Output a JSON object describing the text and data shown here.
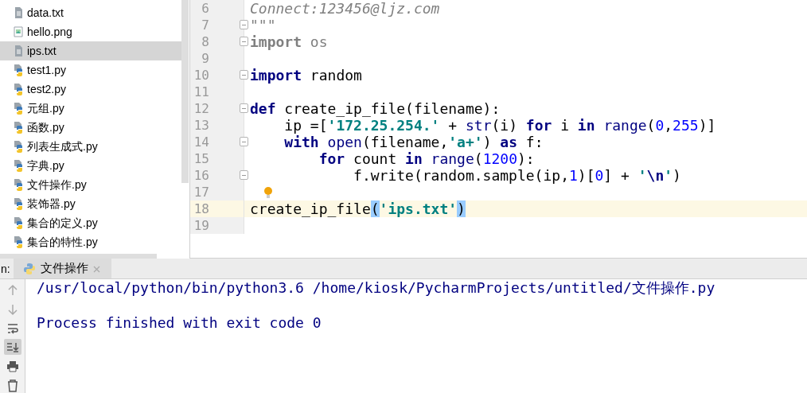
{
  "project_tree": {
    "items": [
      {
        "name": "data.txt",
        "kind": "text",
        "selected": false
      },
      {
        "name": "hello.png",
        "kind": "image",
        "selected": false
      },
      {
        "name": "ips.txt",
        "kind": "text",
        "selected": true
      },
      {
        "name": "test1.py",
        "kind": "python",
        "selected": false
      },
      {
        "name": "test2.py",
        "kind": "python",
        "selected": false
      },
      {
        "name": "元组.py",
        "kind": "python",
        "selected": false
      },
      {
        "name": "函数.py",
        "kind": "python",
        "selected": false
      },
      {
        "name": "列表生成式.py",
        "kind": "python",
        "selected": false
      },
      {
        "name": "字典.py",
        "kind": "python",
        "selected": false
      },
      {
        "name": "文件操作.py",
        "kind": "python",
        "selected": false
      },
      {
        "name": "装饰器.py",
        "kind": "python",
        "selected": false
      },
      {
        "name": "集合的定义.py",
        "kind": "python",
        "selected": false
      },
      {
        "name": "集合的特性.py",
        "kind": "python",
        "selected": false
      }
    ]
  },
  "editor": {
    "lines": [
      {
        "number": "6",
        "tokens": [
          {
            "text": "Connect:123456@ljz.com",
            "kind": "doc"
          }
        ]
      },
      {
        "number": "7",
        "fold_marker": true,
        "tokens": [
          {
            "text": "\"\"\"",
            "kind": "doc"
          }
        ]
      },
      {
        "number": "8",
        "fold_marker": true,
        "tokens": [
          {
            "text": "import",
            "kind": "unused-keyword"
          },
          {
            "text": " os",
            "kind": "unused"
          }
        ]
      },
      {
        "number": "9"
      },
      {
        "number": "10",
        "fold_marker": true,
        "tokens": [
          {
            "text": "import",
            "kind": "keyword"
          },
          {
            "text": " random",
            "kind": "plain"
          }
        ]
      },
      {
        "number": "11"
      },
      {
        "number": "12",
        "fold_marker": true,
        "tokens": [
          {
            "text": "def",
            "kind": "keyword"
          },
          {
            "text": " create_ip_file(filename):",
            "kind": "plain"
          }
        ]
      },
      {
        "number": "13",
        "tokens": [
          {
            "text": "    ip =[",
            "kind": "plain"
          },
          {
            "text": "'172.25.254.'",
            "kind": "string"
          },
          {
            "text": " + ",
            "kind": "plain"
          },
          {
            "text": "str",
            "kind": "builtin"
          },
          {
            "text": "(i) ",
            "kind": "plain"
          },
          {
            "text": "for",
            "kind": "keyword"
          },
          {
            "text": " i ",
            "kind": "plain"
          },
          {
            "text": "in",
            "kind": "keyword"
          },
          {
            "text": " range",
            "kind": "builtin"
          },
          {
            "text": "(",
            "kind": "plain"
          },
          {
            "text": "0",
            "kind": "number"
          },
          {
            "text": ",",
            "kind": "plain"
          },
          {
            "text": "255",
            "kind": "number"
          },
          {
            "text": ")]",
            "kind": "plain"
          }
        ]
      },
      {
        "number": "14",
        "fold_marker": true,
        "tokens": [
          {
            "text": "    with",
            "kind": "keyword"
          },
          {
            "text": " open",
            "kind": "builtin"
          },
          {
            "text": "(filename,",
            "kind": "plain"
          },
          {
            "text": "'a+'",
            "kind": "string"
          },
          {
            "text": ") ",
            "kind": "plain"
          },
          {
            "text": "as",
            "kind": "keyword"
          },
          {
            "text": " f:",
            "kind": "plain"
          }
        ]
      },
      {
        "number": "15",
        "tokens": [
          {
            "text": "        for",
            "kind": "keyword"
          },
          {
            "text": " count ",
            "kind": "plain"
          },
          {
            "text": "in",
            "kind": "keyword"
          },
          {
            "text": " range",
            "kind": "builtin"
          },
          {
            "text": "(",
            "kind": "plain"
          },
          {
            "text": "1200",
            "kind": "number"
          },
          {
            "text": "):",
            "kind": "plain"
          }
        ]
      },
      {
        "number": "16",
        "fold_marker": true,
        "tokens": [
          {
            "text": "            f.write(random.sample(ip,",
            "kind": "plain"
          },
          {
            "text": "1",
            "kind": "number"
          },
          {
            "text": ")[",
            "kind": "plain"
          },
          {
            "text": "0",
            "kind": "number"
          },
          {
            "text": "] + ",
            "kind": "plain"
          },
          {
            "text": "'",
            "kind": "string"
          },
          {
            "text": "\\n",
            "kind": "escape"
          },
          {
            "text": "'",
            "kind": "string"
          },
          {
            "text": ")",
            "kind": "plain"
          }
        ]
      },
      {
        "number": "17",
        "bulb": true
      },
      {
        "number": "18",
        "current": true,
        "tokens": [
          {
            "text": "create_ip_file",
            "kind": "plain"
          },
          {
            "text": "(",
            "kind": "bracket-match"
          },
          {
            "text": "'ips.txt'",
            "kind": "string"
          },
          {
            "text": ")",
            "kind": "bracket-match"
          }
        ]
      },
      {
        "number": "19"
      }
    ]
  },
  "run_panel": {
    "label": "n:",
    "tabs": [
      {
        "title": "文件操作",
        "selected": true
      }
    ],
    "toolbar": [
      {
        "kind": "up",
        "selected": false
      },
      {
        "kind": "down",
        "selected": false
      },
      {
        "kind": "wrap",
        "selected": false
      },
      {
        "kind": "scroll-end",
        "selected": true
      },
      {
        "kind": "print",
        "selected": false
      },
      {
        "kind": "trash",
        "selected": false
      }
    ],
    "output": [
      {
        "text": "/usr/local/python/bin/python3.6 /home/kiosk/PycharmProjects/untitled/文件操作.py"
      },
      {
        "text": "Process finished with exit code 0"
      }
    ]
  }
}
